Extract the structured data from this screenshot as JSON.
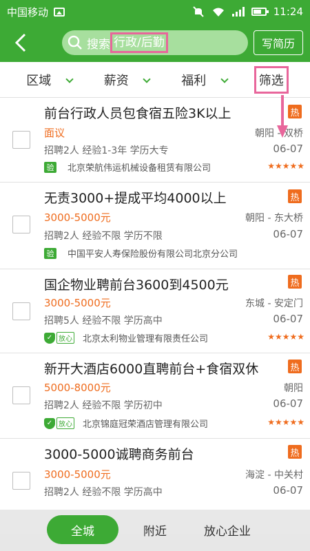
{
  "status_bar": {
    "carrier": "中国移动",
    "time": "11:24"
  },
  "header": {
    "search_label": "搜索",
    "search_keyword": "行政/后勤",
    "write_resume_button": "写简历"
  },
  "filters": [
    {
      "label": "区域"
    },
    {
      "label": "薪资"
    },
    {
      "label": "福利"
    },
    {
      "label": "筛选"
    }
  ],
  "jobs": [
    {
      "title": "前台行政人员包食宿五险3K以上",
      "hot": "热",
      "salary": "面议",
      "location": "朝阳 - 双桥",
      "requirements": "招聘2人 经验1-3年 学历大专",
      "date": "06-07",
      "badge": "验",
      "company": "北京荣航伟运机械设备租赁有限公司",
      "stars": "★★★★★"
    },
    {
      "title": "无责3000+提成平均4000以上",
      "hot": "热",
      "salary": "3000-5000元",
      "location": "朝阳 - 东大桥",
      "requirements": "招聘2人 经验不限 学历不限",
      "date": "06-07",
      "badge": "验",
      "company": "中国平安人寿保险股份有限公司北京分公司",
      "stars": ""
    },
    {
      "title": "国企物业聘前台3600到4500元",
      "hot": "热",
      "salary": "3000-5000元",
      "location": "东城 - 安定门",
      "requirements": "招聘5人 经验不限 学历高中",
      "date": "06-07",
      "badge": "放心",
      "company": "北京太利物业管理有限责任公司",
      "stars": "★★★★★"
    },
    {
      "title": "新开大酒店6000直聘前台+食宿双休",
      "hot": "热",
      "salary": "5000-8000元",
      "location": "朝阳",
      "requirements": "招聘2人 经验不限 学历初中",
      "date": "06-07",
      "badge": "放心",
      "company": "北京锦庭冠荣酒店管理有限公司",
      "stars": "★★★★★"
    },
    {
      "title": "3000-5000诚聘商务前台",
      "hot": "热",
      "salary": "3000-5000元",
      "location": "海淀 - 中关村",
      "requirements": "招聘2人 经验不限 学历高中",
      "date": "06-07",
      "badge": "",
      "company": "",
      "stars": ""
    }
  ],
  "bottom_tabs": [
    {
      "label": "全城"
    },
    {
      "label": "附近"
    },
    {
      "label": "放心企业"
    }
  ],
  "colors": {
    "primary": "#3daa35",
    "orange": "#ef6c1e",
    "highlight": "#e8669b"
  }
}
